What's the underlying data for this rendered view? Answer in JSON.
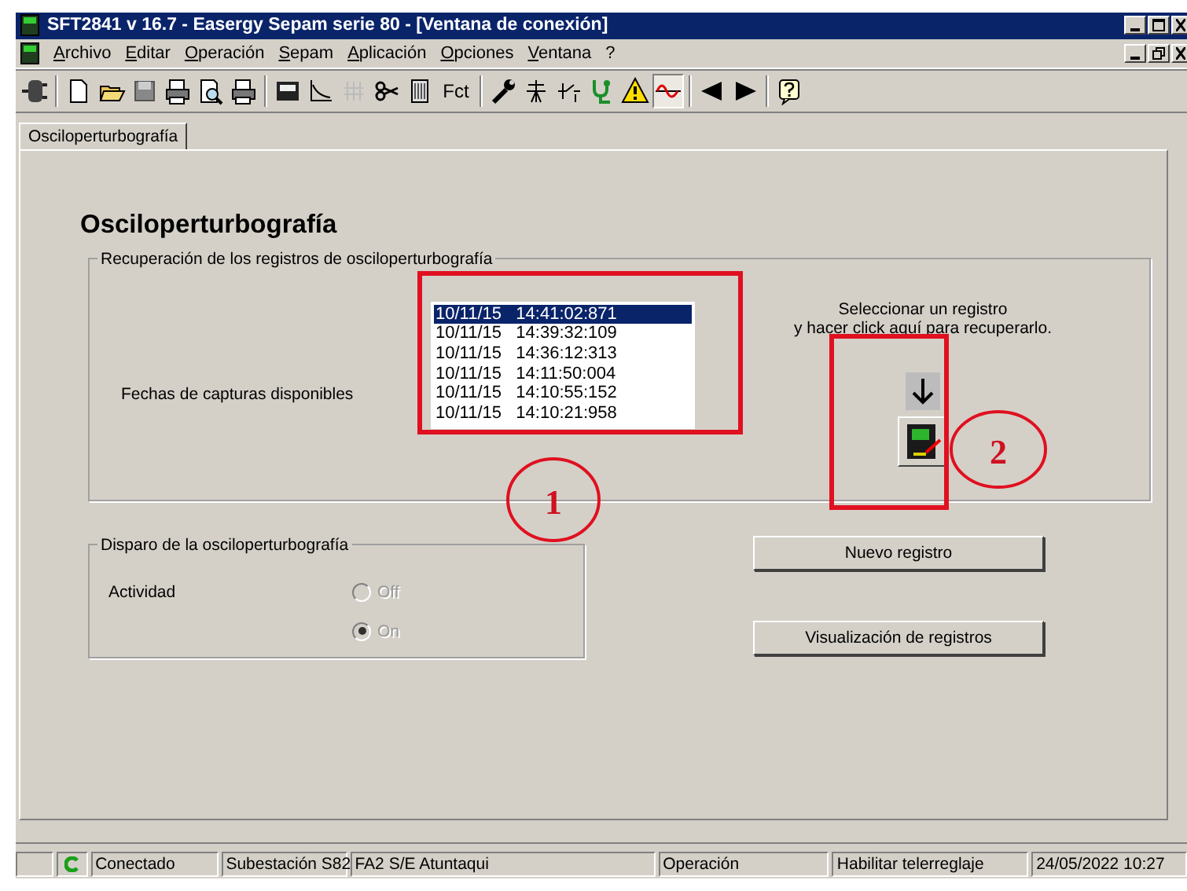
{
  "window": {
    "title": "SFT2841  v 16.7 - Easergy Sepam serie 80 - [Ventana de conexión]"
  },
  "menu": [
    "Archivo",
    "Editar",
    "Operación",
    "Sepam",
    "Aplicación",
    "Opciones",
    "Ventana",
    "?"
  ],
  "toolbar": [
    {
      "kind": "plug",
      "pressed": false
    },
    {
      "kind": "sep"
    },
    {
      "kind": "new",
      "pressed": false
    },
    {
      "kind": "open",
      "pressed": false
    },
    {
      "kind": "save",
      "pressed": false
    },
    {
      "kind": "print",
      "pressed": false
    },
    {
      "kind": "preview",
      "pressed": false
    },
    {
      "kind": "print",
      "pressed": false
    },
    {
      "kind": "sep"
    },
    {
      "kind": "device",
      "pressed": false
    },
    {
      "kind": "curve",
      "pressed": false
    },
    {
      "kind": "grid",
      "pressed": false
    },
    {
      "kind": "scissors",
      "pressed": false
    },
    {
      "kind": "file",
      "pressed": false
    },
    {
      "kind": "text",
      "label": "Fct",
      "pressed": false
    },
    {
      "kind": "sep"
    },
    {
      "kind": "wrench",
      "pressed": false
    },
    {
      "kind": "tower",
      "pressed": false
    },
    {
      "kind": "switch",
      "pressed": false
    },
    {
      "kind": "steth",
      "pressed": false
    },
    {
      "kind": "warning",
      "pressed": false
    },
    {
      "kind": "wave",
      "pressed": true
    },
    {
      "kind": "sep"
    },
    {
      "kind": "left",
      "pressed": false
    },
    {
      "kind": "right",
      "pressed": false
    },
    {
      "kind": "sep"
    },
    {
      "kind": "help",
      "pressed": false
    }
  ],
  "tabs": [
    {
      "label": "Osciloperturbografía",
      "selected": true
    }
  ],
  "heading": "Osciloperturbografía",
  "recovery": {
    "title": "Recuperación de los registros de osciloperturbografía",
    "label": "Fechas de capturas disponibles",
    "records": [
      {
        "date": "10/11/15",
        "time": "14:41:02:871",
        "selected": true
      },
      {
        "date": "10/11/15",
        "time": "14:39:32:109",
        "selected": false
      },
      {
        "date": "10/11/15",
        "time": "14:36:12:313",
        "selected": false
      },
      {
        "date": "10/11/15",
        "time": "14:11:50:004",
        "selected": false
      },
      {
        "date": "10/11/15",
        "time": "14:10:55:152",
        "selected": false
      },
      {
        "date": "10/11/15",
        "time": "14:10:21:958",
        "selected": false
      }
    ],
    "hint_1": "Seleccionar un registro",
    "hint_2": "y hacer click aquí para recuperarlo."
  },
  "trigger": {
    "title": "Disparo de la osciloperturbografía",
    "label": "Actividad",
    "options": [
      {
        "label": "Off",
        "selected": false,
        "disabled": true
      },
      {
        "label": "On",
        "selected": true,
        "disabled": true
      }
    ]
  },
  "buttons": [
    "Nuevo registro",
    "Visualización de registros"
  ],
  "annotations": [
    "1",
    "2"
  ],
  "status_bar": [
    "Conectado",
    "Subestación S82",
    "FA2 S/E Atuntaqui",
    "Operación",
    "Habilitar telerreglaje",
    "24/05/2022  10:27"
  ]
}
